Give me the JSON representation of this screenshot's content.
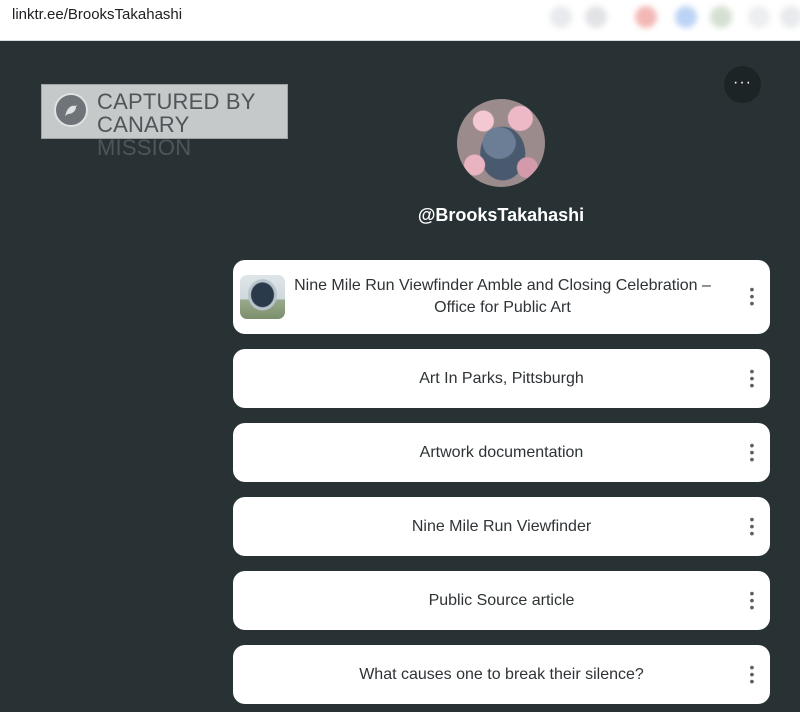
{
  "browser": {
    "url": "linktr.ee/BrooksTakahashi"
  },
  "watermark": {
    "line1": "CAPTURED BY",
    "line2": "CANARY MISSION"
  },
  "profile": {
    "handle": "@BrooksTakahashi",
    "more_label": "···"
  },
  "links": [
    {
      "line1": "Nine Mile Run Viewfinder Amble and Closing Celebration –",
      "line2": "Office for Public Art"
    },
    {
      "label": "Art In Parks, Pittsburgh"
    },
    {
      "label": "Artwork documentation"
    },
    {
      "label": "Nine Mile Run Viewfinder"
    },
    {
      "label": "Public Source article"
    },
    {
      "label": "What causes one to break their silence?"
    }
  ]
}
